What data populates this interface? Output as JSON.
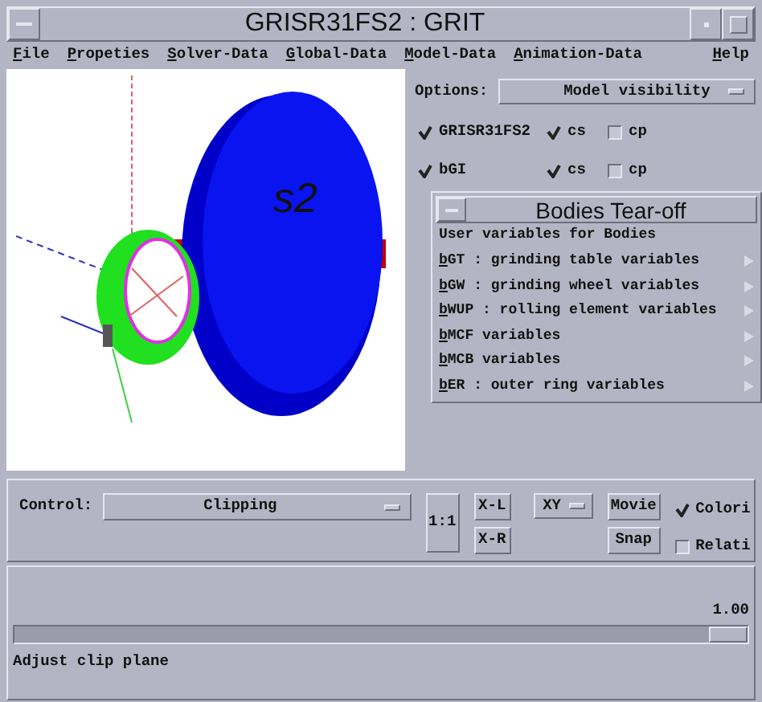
{
  "window": {
    "title": "GRISR31FS2 : GRIT"
  },
  "menu": [
    {
      "label": "File"
    },
    {
      "label": "Propeties"
    },
    {
      "label": "Solver-Data"
    },
    {
      "label": "Global-Data"
    },
    {
      "label": "Model-Data"
    },
    {
      "label": "Animation-Data"
    }
  ],
  "help_menu": {
    "label": "Help"
  },
  "viewport": {
    "body_label": "s2"
  },
  "options": {
    "label": "Options:",
    "value": "Model visibility"
  },
  "visibility_rows": [
    {
      "items": [
        {
          "label": "GRISR31FS2",
          "checked": true
        },
        {
          "label": "cs",
          "checked": true
        },
        {
          "label": "cp",
          "checked": false
        }
      ]
    },
    {
      "items": [
        {
          "label": "bGI",
          "checked": true
        },
        {
          "label": "cs",
          "checked": true
        },
        {
          "label": "cp",
          "checked": false
        }
      ]
    }
  ],
  "tearoff": {
    "title": "Bodies Tear-off",
    "header": "User variables for Bodies",
    "items": [
      {
        "label": "bGT : grinding table variables"
      },
      {
        "label": "bGW : grinding wheel variables"
      },
      {
        "label": "bWUP : rolling element variables"
      },
      {
        "label": "bMCF variables"
      },
      {
        "label": "bMCB variables"
      },
      {
        "label": "bER : outer ring variables"
      }
    ]
  },
  "control": {
    "label": "Control:",
    "value": "Clipping"
  },
  "scale_button": "1:1",
  "side_buttons": [
    "X-L",
    "X-R"
  ],
  "plane_select": "XY",
  "action_buttons": [
    "Movie",
    "Snap"
  ],
  "toggles": [
    {
      "label": "Colori",
      "checked": true
    },
    {
      "label": "Relati",
      "checked": false
    }
  ],
  "slider": {
    "reading": "1.00",
    "level": 1
  },
  "status": "Adjust clip plane"
}
